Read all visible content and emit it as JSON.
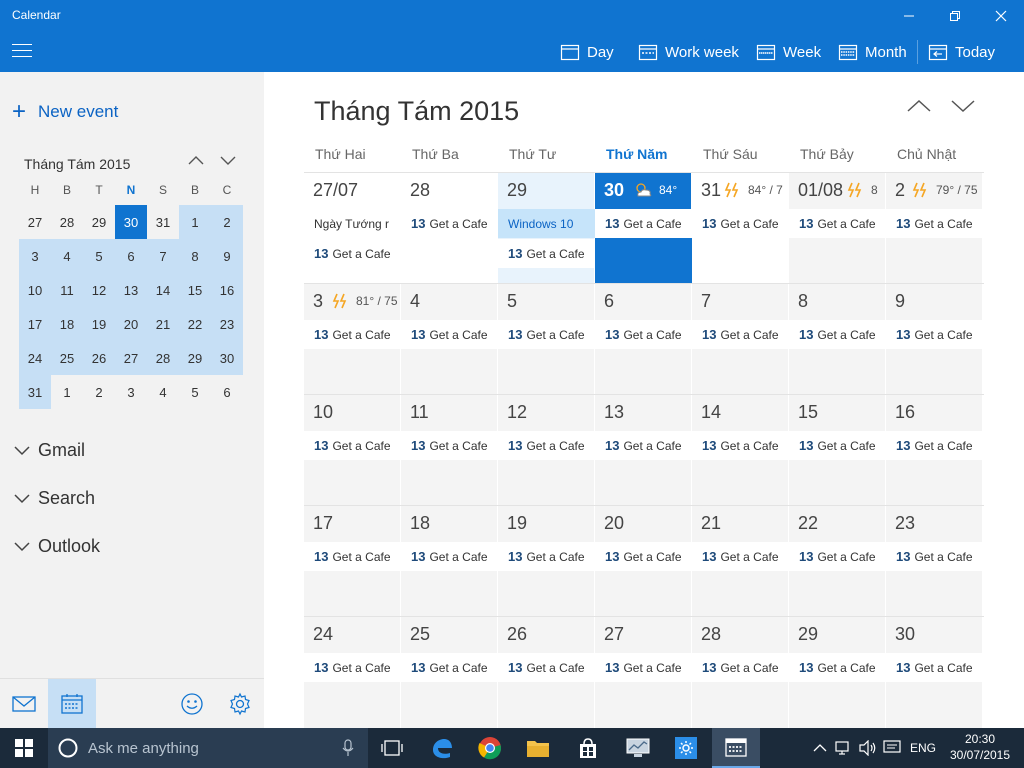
{
  "window": {
    "title": "Calendar"
  },
  "toolbar": {
    "views": [
      {
        "label": "Day",
        "icon": "calendar-day-icon"
      },
      {
        "label": "Work week",
        "icon": "calendar-workweek-icon"
      },
      {
        "label": "Week",
        "icon": "calendar-week-icon"
      },
      {
        "label": "Month",
        "icon": "calendar-month-icon"
      },
      {
        "label": "Today",
        "icon": "calendar-today-icon"
      }
    ]
  },
  "sidebar": {
    "new_event": "New event",
    "mini_calendar": {
      "title": "Tháng Tám 2015",
      "weekdays": [
        "H",
        "B",
        "T",
        "N",
        "S",
        "B",
        "C"
      ],
      "today_weekday_index": 3,
      "weeks": [
        [
          "27",
          "28",
          "29",
          "30",
          "31",
          "1",
          "2"
        ],
        [
          "3",
          "4",
          "5",
          "6",
          "7",
          "8",
          "9"
        ],
        [
          "10",
          "11",
          "12",
          "13",
          "14",
          "15",
          "16"
        ],
        [
          "17",
          "18",
          "19",
          "20",
          "21",
          "22",
          "23"
        ],
        [
          "24",
          "25",
          "26",
          "27",
          "28",
          "29",
          "30"
        ],
        [
          "31",
          "1",
          "2",
          "3",
          "4",
          "5",
          "6"
        ]
      ]
    },
    "accounts": [
      "Gmail",
      "Search",
      "Outlook"
    ]
  },
  "main": {
    "month_title": "Tháng Tám 2015",
    "weekdays": [
      "Thứ Hai",
      "Thứ Ba",
      "Thứ Tư",
      "Thứ Năm",
      "Thứ Sáu",
      "Thứ Bảy",
      "Chủ Nhật"
    ],
    "today_weekday_index": 3,
    "event_day": "13",
    "event_title": "Get a Cafe",
    "weeks": [
      {
        "days": [
          "27/07",
          "28",
          "29",
          "30",
          "31",
          "01/08",
          "2"
        ]
      },
      {
        "days": [
          "3",
          "4",
          "5",
          "6",
          "7",
          "8",
          "9"
        ]
      },
      {
        "days": [
          "10",
          "11",
          "12",
          "13",
          "14",
          "15",
          "16"
        ]
      },
      {
        "days": [
          "17",
          "18",
          "19",
          "20",
          "21",
          "22",
          "23"
        ]
      },
      {
        "days": [
          "24",
          "25",
          "26",
          "27",
          "28",
          "29",
          "30"
        ]
      }
    ],
    "special_events": {
      "holiday": "Ngày Tướng r",
      "windows": "Windows 10"
    },
    "weather": {
      "thu": "84°",
      "fri": "84° / 7",
      "sat": "8",
      "sun": "79° / 75",
      "mon_next": "81° / 75"
    }
  },
  "taskbar": {
    "search_placeholder": "Ask me anything",
    "language": "ENG",
    "time": "20:30",
    "date": "30/07/2015"
  }
}
